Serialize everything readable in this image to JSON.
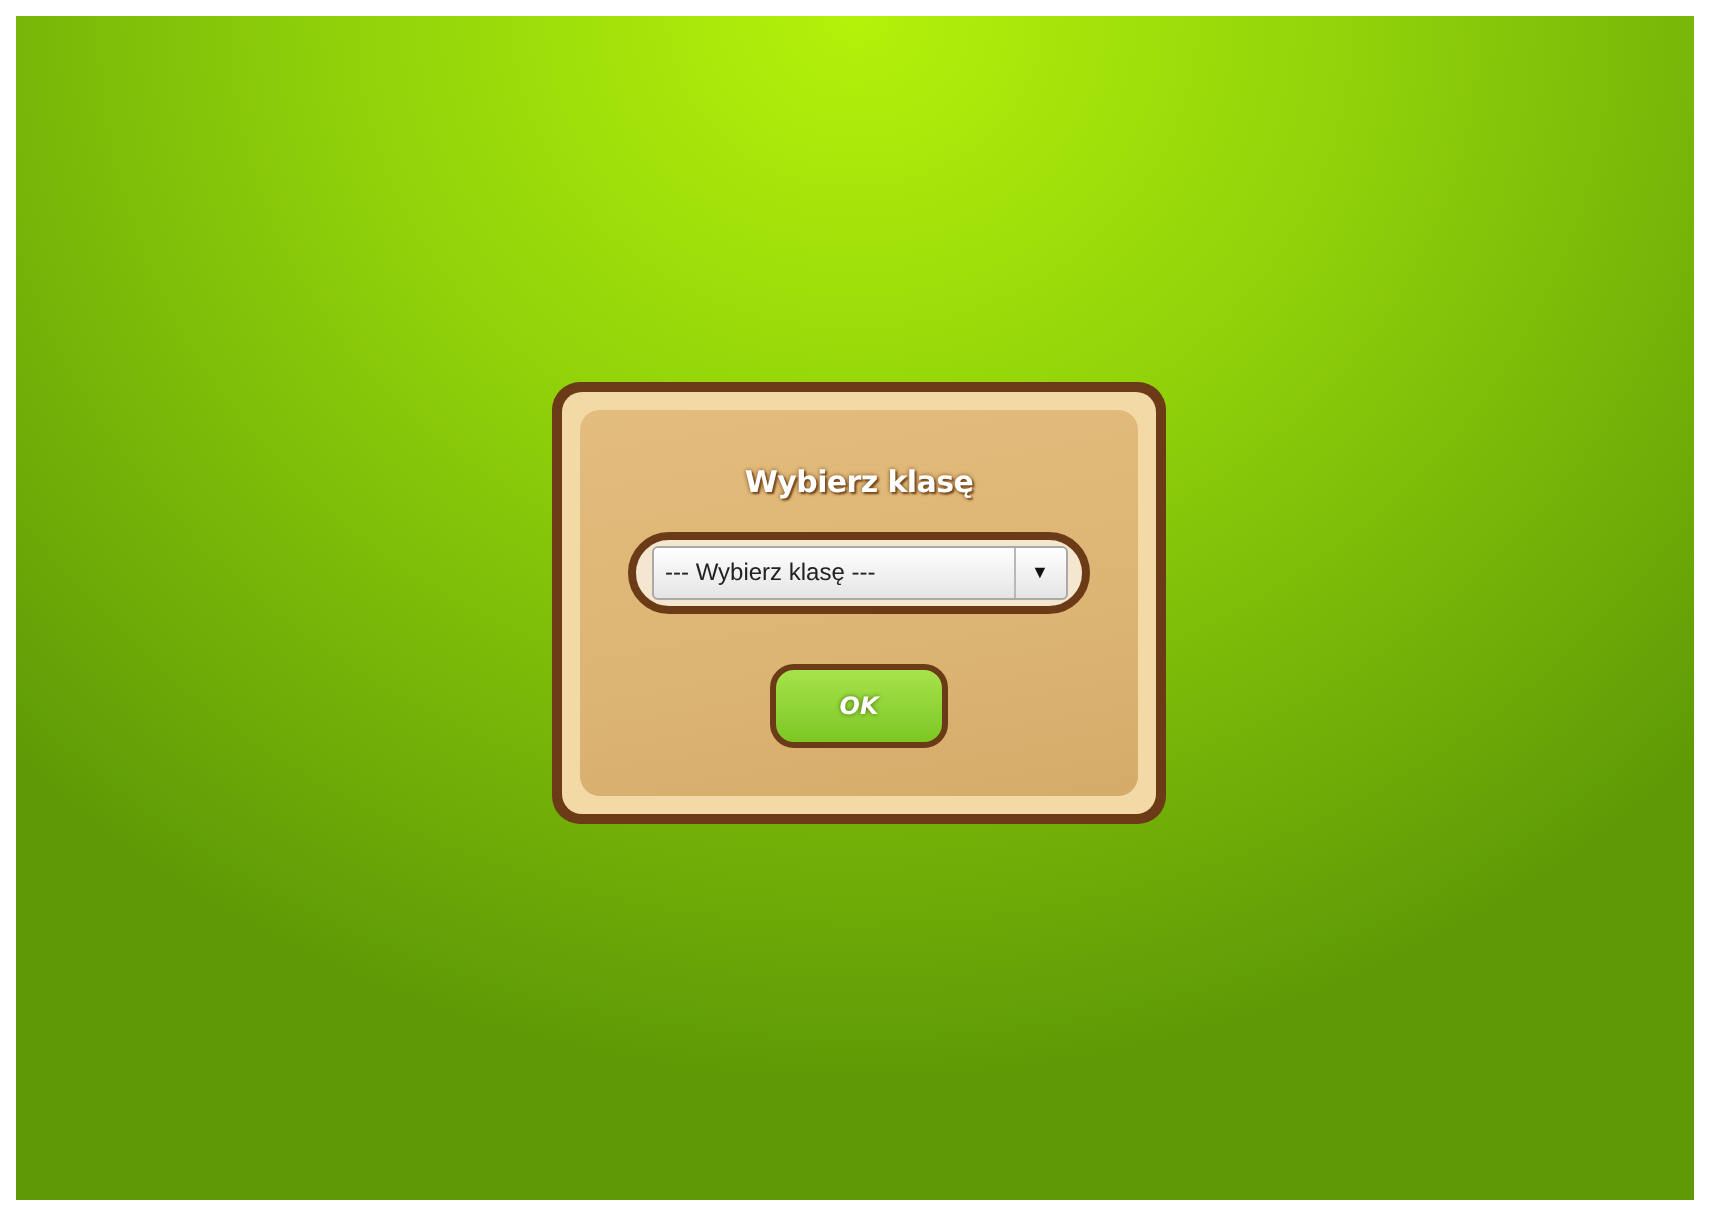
{
  "dialog": {
    "title": "Wybierz klasę",
    "select": {
      "value": "--- Wybierz klasę ---",
      "arrow": "▼"
    },
    "buttons": [
      "OK"
    ]
  }
}
